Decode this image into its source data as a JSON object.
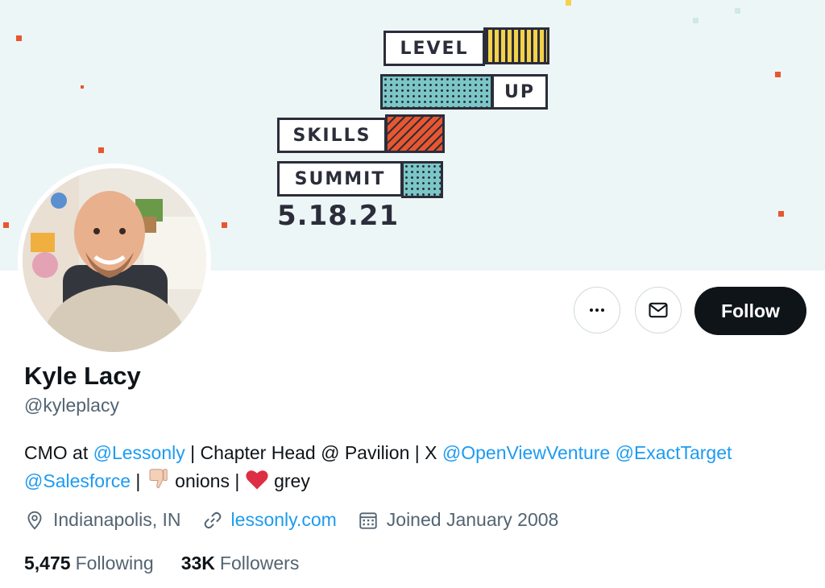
{
  "banner": {
    "logo_lines": [
      "LEVEL",
      "UP",
      "SKILLS",
      "SUMMIT"
    ],
    "date": "5.18.21",
    "colors": {
      "background": "#edf6f6",
      "accent_orange": "#e8562f",
      "accent_yellow": "#f3d24a",
      "accent_teal": "#7bc7c7",
      "ink": "#2b2d3a"
    }
  },
  "profile": {
    "name": "Kyle Lacy",
    "handle": "@kyleplacy",
    "bio": {
      "p1": "CMO at ",
      "m1": "@Lessonly",
      "p2": " | Chapter Head @ Pavilion | X ",
      "m2": "@OpenViewVenture",
      "p3": " ",
      "m3": "@ExactTarget",
      "m4": "@Salesforce",
      "p4": " | ",
      "emoji1": "thumbs-down",
      "p5": " onions | ",
      "emoji2": "red-heart",
      "p6": " grey"
    },
    "location": "Indianapolis, IN",
    "website": "lessonly.com",
    "joined": "Joined January 2008",
    "following_count": "5,475",
    "following_label": "Following",
    "followers_count": "33K",
    "followers_label": "Followers"
  },
  "actions": {
    "more_icon": "more-icon",
    "message_icon": "mail-icon",
    "follow_label": "Follow"
  },
  "colors": {
    "link": "#1d9bf0",
    "text": "#0f1419",
    "secondary": "#536471",
    "button_dark": "#0f1419"
  }
}
